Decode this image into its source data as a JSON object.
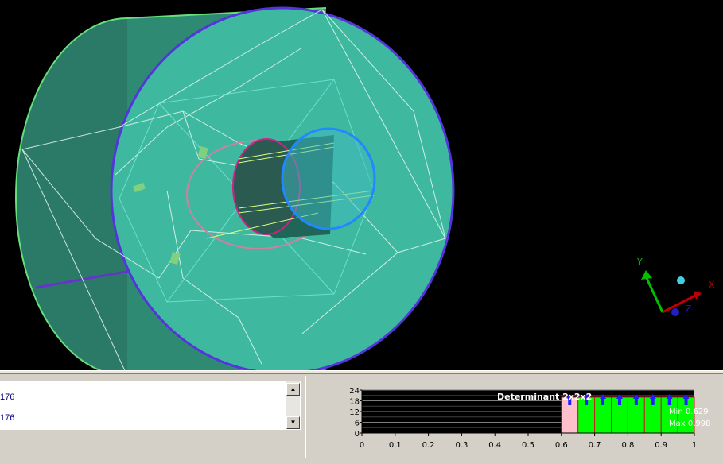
{
  "viewport": {
    "background": "#000000",
    "axes": {
      "y_label": "Y",
      "x_label": "X",
      "z_label": "Z"
    }
  },
  "list": {
    "rows": [
      "176",
      "176"
    ],
    "scroll_up_icon": "arrow-up-icon",
    "scroll_down_icon": "arrow-down-icon"
  },
  "chart_data": {
    "type": "bar",
    "title": "Determinant 2x2x2",
    "min_label": "Min 0.629",
    "max_label": "Max 0.998",
    "x_ticks": [
      "0",
      "0.1",
      "0.2",
      "0.3",
      "0.4",
      "0.5",
      "0.6",
      "0.7",
      "0.8",
      "0.9",
      "1"
    ],
    "y_ticks": [
      "24",
      "18",
      "12",
      "6",
      "0"
    ],
    "xlim": [
      0,
      1
    ],
    "ylim": [
      0,
      24
    ],
    "grid": true,
    "bins": [
      {
        "x0": 0.6,
        "x1": 0.65,
        "value": 20,
        "color": "#ffc0cb"
      },
      {
        "x0": 0.65,
        "x1": 0.7,
        "value": 20,
        "color": "#00ff00"
      },
      {
        "x0": 0.7,
        "x1": 0.75,
        "value": 20,
        "color": "#00ff00"
      },
      {
        "x0": 0.75,
        "x1": 0.8,
        "value": 20,
        "color": "#00ff00"
      },
      {
        "x0": 0.8,
        "x1": 0.85,
        "value": 20,
        "color": "#00ff00"
      },
      {
        "x0": 0.85,
        "x1": 0.9,
        "value": 20,
        "color": "#00ff00"
      },
      {
        "x0": 0.9,
        "x1": 0.95,
        "value": 20,
        "color": "#00ff00"
      },
      {
        "x0": 0.95,
        "x1": 1.0,
        "value": 20,
        "color": "#00ff00"
      }
    ]
  }
}
